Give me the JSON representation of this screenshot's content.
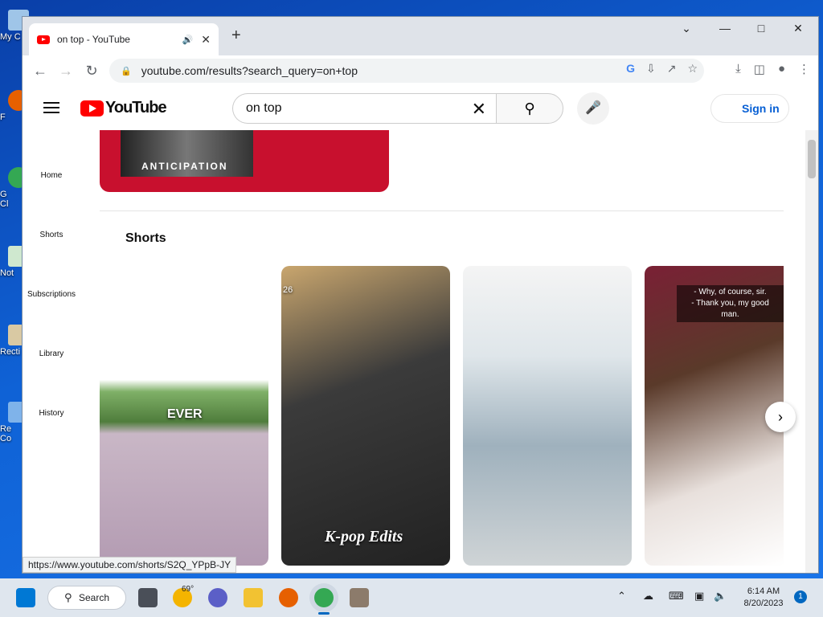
{
  "desktop": {
    "icons": [
      {
        "label": "My C"
      },
      {
        "label": "F"
      },
      {
        "label": "G\nCl"
      },
      {
        "label": "Not"
      },
      {
        "label": "Recti"
      },
      {
        "label": "Re\nCo"
      }
    ]
  },
  "browser": {
    "tab_title": "on top - YouTube",
    "url": "youtube.com/results?search_query=on+top",
    "status_url": "https://www.youtube.com/shorts/S2Q_YPpB-JY"
  },
  "youtube": {
    "logo_text": "YouTube",
    "search_value": "on top",
    "sign_in_label": "Sign in",
    "sidebar": [
      "Home",
      "Shorts",
      "Subscriptions",
      "Library",
      "History"
    ],
    "banner_text": "ANTICIPATION",
    "shorts_heading": "Shorts",
    "shorts": [
      {
        "overlay": "EVER"
      },
      {
        "overlay": "K-pop Edits",
        "corner": "26"
      },
      {
        "overlay": ""
      },
      {
        "caption_line1": "- Why, of course, sir.",
        "caption_line2": "- Thank you, my good man."
      }
    ]
  },
  "taskbar": {
    "search_label": "Search",
    "weather_temp": "69°",
    "time": "6:14 AM",
    "date": "8/20/2023",
    "notifications": "1"
  },
  "colors": {
    "youtube_red": "#ff0000",
    "link_blue": "#065fd4"
  }
}
